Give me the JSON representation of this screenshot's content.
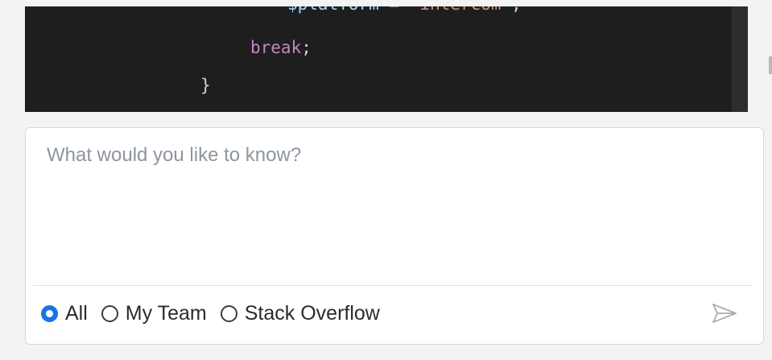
{
  "code": {
    "line1": {
      "var": "$platform",
      "op": " = ",
      "str": "'intercom'",
      "punc": ";"
    },
    "line2": {
      "kw": "break",
      "punc": ";"
    },
    "line3": {
      "punc": "}"
    }
  },
  "prompt": {
    "placeholder": "What would you like to know?",
    "value": ""
  },
  "scope_options": {
    "selected": "All",
    "items": [
      {
        "label": "All",
        "checked": true
      },
      {
        "label": "My Team",
        "checked": false
      },
      {
        "label": "Stack Overflow",
        "checked": false
      }
    ]
  },
  "icons": {
    "send": "send-icon"
  },
  "colors": {
    "accent": "#1a73e8",
    "code_bg": "#1e1e1e"
  }
}
